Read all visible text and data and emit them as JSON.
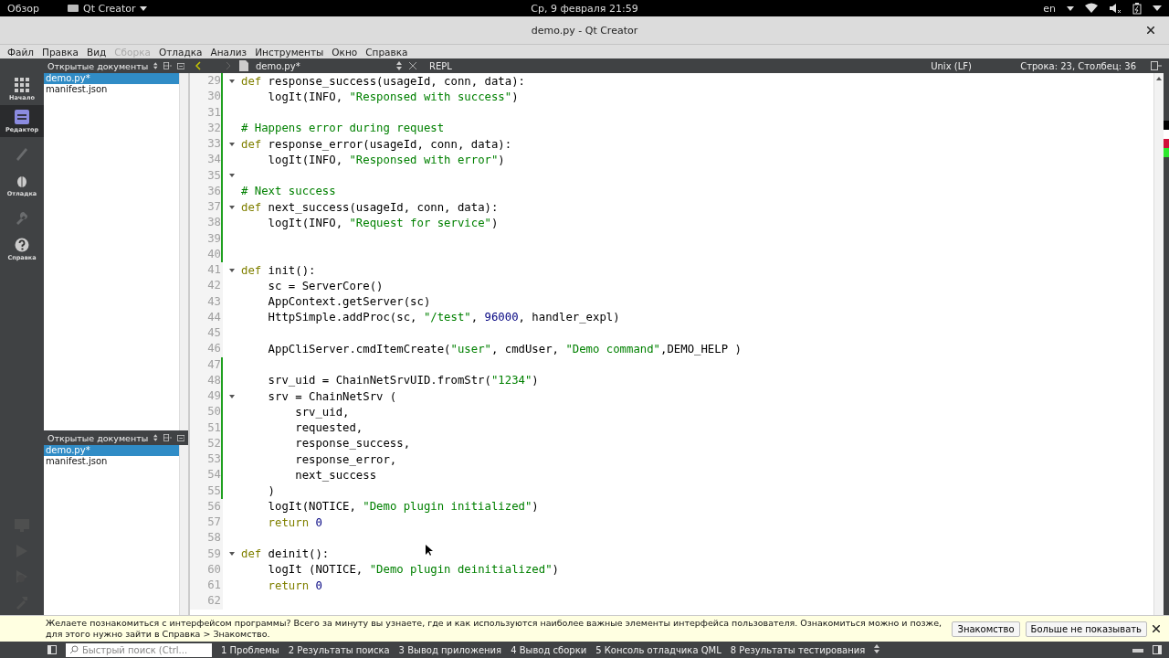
{
  "top_bar": {
    "activities": "Обзор",
    "app_menu": "Qt Creator",
    "clock": "Ср, 9 февраля  21:59",
    "language": "en"
  },
  "window": {
    "title": "demo.py - Qt Creator"
  },
  "menu": [
    {
      "label": "Файл",
      "disabled": false
    },
    {
      "label": "Правка",
      "disabled": false
    },
    {
      "label": "Вид",
      "disabled": false
    },
    {
      "label": "Сборка",
      "disabled": true
    },
    {
      "label": "Отладка",
      "disabled": false
    },
    {
      "label": "Анализ",
      "disabled": false
    },
    {
      "label": "Инструменты",
      "disabled": false
    },
    {
      "label": "Окно",
      "disabled": false
    },
    {
      "label": "Справка",
      "disabled": false
    }
  ],
  "modes": [
    {
      "kind": "grid",
      "label": "Начало",
      "selected": false,
      "disabled": false
    },
    {
      "kind": "editor",
      "label": "Редактор",
      "selected": true,
      "disabled": false
    },
    {
      "kind": "pen",
      "selected": false,
      "disabled": true
    },
    {
      "kind": "bug",
      "label": "Отладка",
      "selected": false,
      "disabled": false
    },
    {
      "kind": "wrench",
      "selected": false,
      "disabled": true
    },
    {
      "kind": "help",
      "label": "Справка",
      "selected": false,
      "disabled": false
    }
  ],
  "open_documents_panels": [
    {
      "title": "Открытые документы",
      "files": [
        {
          "name": "demo.py*",
          "selected": true
        },
        {
          "name": "manifest.json",
          "selected": false
        }
      ]
    },
    {
      "title": "Открытые документы",
      "files": [
        {
          "name": "demo.py*",
          "selected": true
        },
        {
          "name": "manifest.json",
          "selected": false
        }
      ]
    }
  ],
  "editor_toolbar": {
    "file": "demo.py*",
    "repl": "REPL",
    "line_endings": "Unix (LF)",
    "position": "Строка: 23, Столбец: 36"
  },
  "code_lines": [
    {
      "number": "29",
      "fold": true,
      "modified": true,
      "tokens": [
        {
          "kind": "kw",
          "text": "def"
        },
        {
          "kind": "p",
          "text": " response_success(usageId, conn, data):"
        }
      ]
    },
    {
      "number": "30",
      "fold": false,
      "modified": true,
      "tokens": [
        {
          "kind": "p",
          "text": "    logIt(INFO, "
        },
        {
          "kind": "str",
          "text": "\"Responsed with success\""
        },
        {
          "kind": "p",
          "text": ")"
        }
      ]
    },
    {
      "number": "31",
      "fold": false,
      "modified": true
    },
    {
      "number": "32",
      "fold": false,
      "modified": true,
      "tokens": [
        {
          "kind": "cmt",
          "text": "# Happens error during request"
        }
      ]
    },
    {
      "number": "33",
      "fold": true,
      "modified": true,
      "tokens": [
        {
          "kind": "kw",
          "text": "def"
        },
        {
          "kind": "p",
          "text": " response_error(usageId, conn, data):"
        }
      ]
    },
    {
      "number": "34",
      "fold": false,
      "modified": true,
      "tokens": [
        {
          "kind": "p",
          "text": "    logIt(INFO, "
        },
        {
          "kind": "str",
          "text": "\"Responsed with error\""
        },
        {
          "kind": "p",
          "text": ")"
        }
      ]
    },
    {
      "number": "35",
      "fold": true,
      "modified": true
    },
    {
      "number": "36",
      "fold": false,
      "modified": true,
      "tokens": [
        {
          "kind": "cmt",
          "text": "# Next success"
        }
      ]
    },
    {
      "number": "37",
      "fold": true,
      "modified": true,
      "tokens": [
        {
          "kind": "kw",
          "text": "def"
        },
        {
          "kind": "p",
          "text": " next_success(usageId, conn, data):"
        }
      ]
    },
    {
      "number": "38",
      "fold": false,
      "modified": true,
      "tokens": [
        {
          "kind": "p",
          "text": "    logIt(INFO, "
        },
        {
          "kind": "str",
          "text": "\"Request for service\""
        },
        {
          "kind": "p",
          "text": ")"
        }
      ]
    },
    {
      "number": "39",
      "fold": false,
      "modified": true
    },
    {
      "number": "40",
      "fold": false,
      "modified": true
    },
    {
      "number": "41",
      "fold": true,
      "modified": false,
      "tokens": [
        {
          "kind": "kw",
          "text": "def"
        },
        {
          "kind": "p",
          "text": " init():"
        }
      ]
    },
    {
      "number": "42",
      "fold": false,
      "modified": false,
      "tokens": [
        {
          "kind": "p",
          "text": "    sc = ServerCore()"
        }
      ]
    },
    {
      "number": "43",
      "fold": false,
      "modified": false,
      "tokens": [
        {
          "kind": "p",
          "text": "    AppContext.getServer(sc)"
        }
      ]
    },
    {
      "number": "44",
      "fold": false,
      "modified": false,
      "tokens": [
        {
          "kind": "p",
          "text": "    HttpSimple.addProc(sc, "
        },
        {
          "kind": "str",
          "text": "\"/test\""
        },
        {
          "kind": "p",
          "text": ", "
        },
        {
          "kind": "num",
          "text": "96000"
        },
        {
          "kind": "p",
          "text": ", handler_expl)"
        }
      ]
    },
    {
      "number": "45",
      "fold": false,
      "modified": false
    },
    {
      "number": "46",
      "fold": false,
      "modified": false,
      "tokens": [
        {
          "kind": "p",
          "text": "    AppCliServer.cmdItemCreate("
        },
        {
          "kind": "str",
          "text": "\"user\""
        },
        {
          "kind": "p",
          "text": ", cmdUser, "
        },
        {
          "kind": "str",
          "text": "\"Demo command\""
        },
        {
          "kind": "p",
          "text": ",DEMO_HELP )"
        }
      ]
    },
    {
      "number": "47",
      "fold": false,
      "modified": true
    },
    {
      "number": "48",
      "fold": false,
      "modified": true,
      "tokens": [
        {
          "kind": "p",
          "text": "    srv_uid = ChainNetSrvUID.fromStr("
        },
        {
          "kind": "str",
          "text": "\"1234\""
        },
        {
          "kind": "p",
          "text": ")"
        }
      ]
    },
    {
      "number": "49",
      "fold": true,
      "modified": true,
      "tokens": [
        {
          "kind": "p",
          "text": "    srv = ChainNetSrv ("
        }
      ]
    },
    {
      "number": "50",
      "fold": false,
      "modified": true,
      "tokens": [
        {
          "kind": "p",
          "text": "        srv_uid,"
        }
      ]
    },
    {
      "number": "51",
      "fold": false,
      "modified": true,
      "tokens": [
        {
          "kind": "p",
          "text": "        requested,"
        }
      ]
    },
    {
      "number": "52",
      "fold": false,
      "modified": true,
      "tokens": [
        {
          "kind": "p",
          "text": "        response_success,"
        }
      ]
    },
    {
      "number": "53",
      "fold": false,
      "modified": true,
      "tokens": [
        {
          "kind": "p",
          "text": "        response_error,"
        }
      ]
    },
    {
      "number": "54",
      "fold": false,
      "modified": true,
      "tokens": [
        {
          "kind": "p",
          "text": "        next_success"
        }
      ]
    },
    {
      "number": "55",
      "fold": false,
      "modified": true,
      "tokens": [
        {
          "kind": "p",
          "text": "    )"
        }
      ]
    },
    {
      "number": "56",
      "fold": false,
      "modified": false,
      "tokens": [
        {
          "kind": "p",
          "text": "    logIt(NOTICE, "
        },
        {
          "kind": "str",
          "text": "\"Demo plugin initialized\""
        },
        {
          "kind": "p",
          "text": ")"
        }
      ]
    },
    {
      "number": "57",
      "fold": false,
      "modified": false,
      "tokens": [
        {
          "kind": "kw",
          "text": "    return"
        },
        {
          "kind": "num",
          "text": " 0"
        }
      ]
    },
    {
      "number": "58",
      "fold": false,
      "modified": false
    },
    {
      "number": "59",
      "fold": true,
      "modified": false,
      "tokens": [
        {
          "kind": "kw",
          "text": "def"
        },
        {
          "kind": "p",
          "text": " deinit():"
        }
      ]
    },
    {
      "number": "60",
      "fold": false,
      "modified": false,
      "tokens": [
        {
          "kind": "p",
          "text": "    logIt (NOTICE, "
        },
        {
          "kind": "str",
          "text": "\"Demo plugin deinitialized\""
        },
        {
          "kind": "p",
          "text": ")"
        }
      ]
    },
    {
      "number": "61",
      "fold": false,
      "modified": false,
      "tokens": [
        {
          "kind": "kw",
          "text": "    return"
        },
        {
          "kind": "num",
          "text": " 0"
        }
      ]
    },
    {
      "number": "62",
      "fold": false,
      "modified": false
    }
  ],
  "info_bar": {
    "message": "Желаете познакомиться с интерфейсом программы? Всего за минуту вы узнаете, где и как используются наиболее важные элементы интерфейса пользователя. Ознакомиться можно и позже, для этого нужно зайти в Справка > Знакомство.",
    "buttons": [
      "Знакомство",
      "Больше не показывать"
    ]
  },
  "status_bar": {
    "search_placeholder": "Быстрый поиск (Ctrl...",
    "panes": [
      "1 Проблемы",
      "2 Результаты поиска",
      "3 Вывод приложения",
      "4 Вывод сборки",
      "5 Консоль отладчика QML",
      "8 Результаты тестирования"
    ]
  }
}
